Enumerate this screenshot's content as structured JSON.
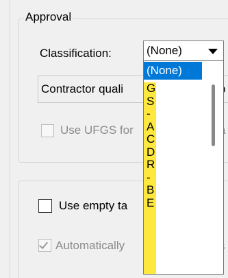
{
  "approval_group": {
    "title": "Approval",
    "classification": {
      "label": "Classification:",
      "value": "(None)",
      "options": [
        "(None)",
        "G",
        "S",
        "-",
        "A",
        "C",
        "D",
        "R",
        "-",
        "B",
        "E"
      ]
    },
    "contractor_quality": {
      "text": "Contractor quali",
      "tail_text": "p"
    },
    "use_ufgs": {
      "label": "Use UFGS for",
      "tail_text": "a",
      "checked": false,
      "enabled": false
    }
  },
  "second_group": {
    "use_empty": {
      "label": "Use empty ta",
      "checked": false
    },
    "automatically": {
      "label": "Automatically",
      "tail_text": "s",
      "checked": true,
      "enabled": false
    }
  },
  "colors": {
    "selection": "#0078d7",
    "highlight": "#ffe83d"
  }
}
